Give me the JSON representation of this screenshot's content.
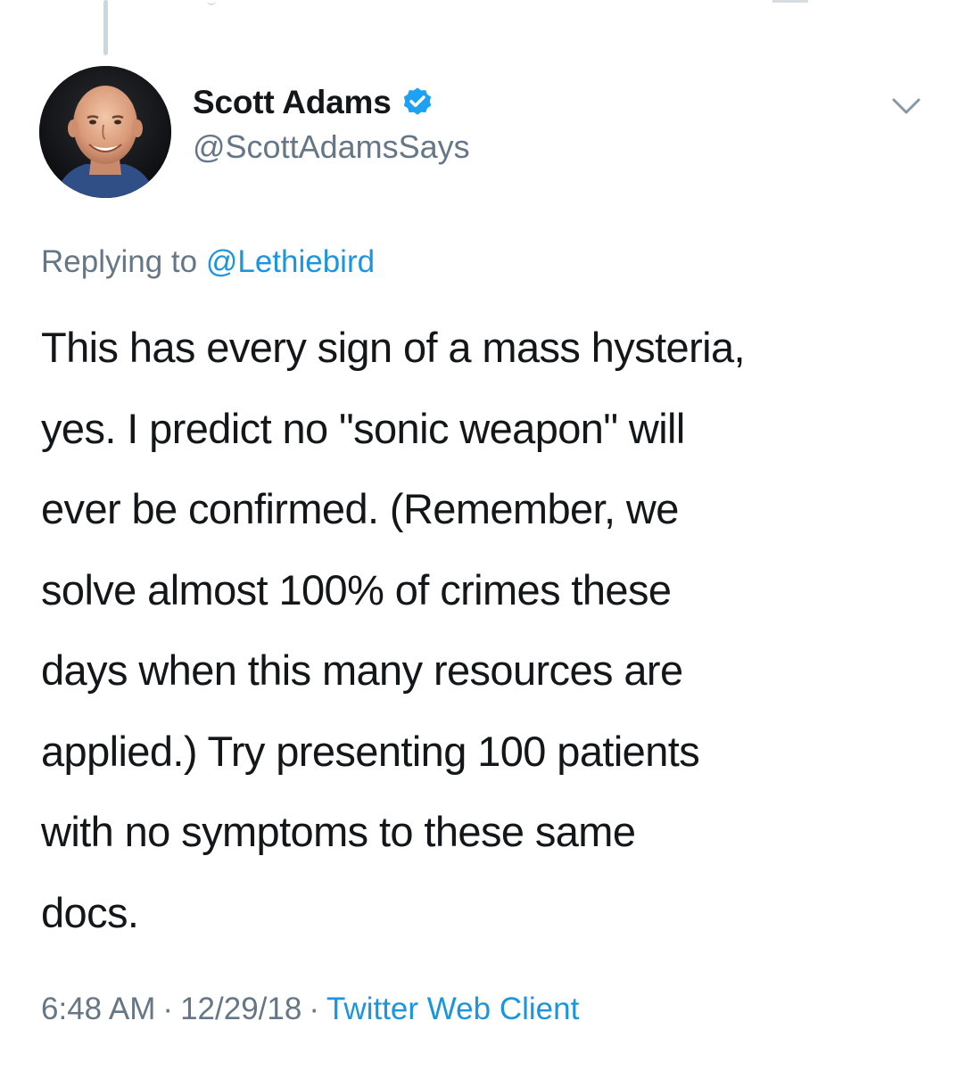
{
  "tweet": {
    "author": {
      "display_name": "Scott Adams",
      "handle": "@ScottAdamsSays",
      "verified": true
    },
    "reply": {
      "prefix": "Replying to ",
      "to_handle": "@Lethiebird"
    },
    "text_lines": [
      "This has every sign of a mass hysteria,",
      "yes. I predict no \"sonic weapon\" will",
      "ever be confirmed. (Remember, we",
      "solve almost 100% of crimes these",
      "days when this many resources are",
      "applied.) Try presenting 100 patients",
      "with no symptoms to these same",
      "docs."
    ],
    "meta": {
      "time": "6:48 AM",
      "separator": "·",
      "date": "12/29/18",
      "source": "Twitter Web Client"
    }
  },
  "icons": {
    "verified": "verified-badge-icon",
    "menu": "chevron-down-icon"
  },
  "colors": {
    "text": "#14171a",
    "secondary": "#657786",
    "link": "#1b95e0",
    "verified": "#1da1f2",
    "thread_line": "#ccd6dd"
  }
}
